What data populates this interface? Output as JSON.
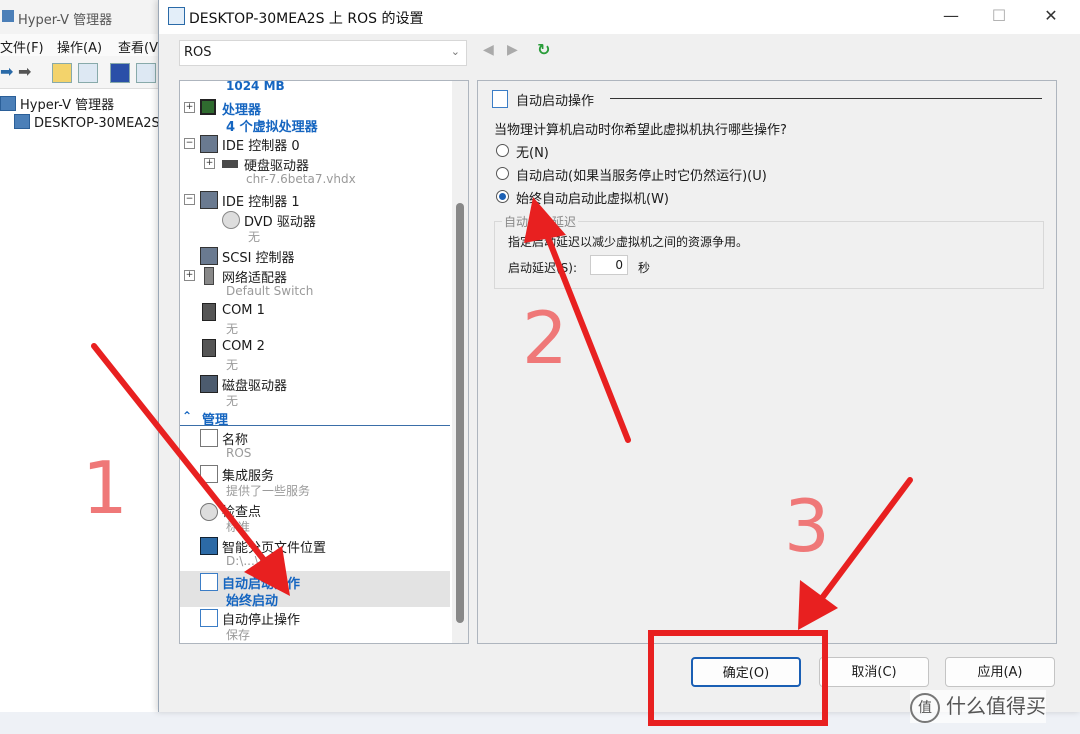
{
  "background_window": {
    "title": "Hyper-V 管理器",
    "menu": [
      "文件(F)",
      "操作(A)",
      "查看(V"
    ],
    "tree": [
      "Hyper-V 管理器",
      "DESKTOP-30MEA2S"
    ]
  },
  "dialog": {
    "title": "DESKTOP-30MEA2S 上 ROS 的设置",
    "minimize": "—",
    "maximize": "☐",
    "close": "✕",
    "vm_select": "ROS",
    "nav_back": "◀",
    "nav_forward": "▶",
    "refresh": "↻"
  },
  "left_panel": {
    "memory_sub": "1024 MB",
    "processor": {
      "label": "处理器",
      "sub": "4 个虚拟处理器"
    },
    "ide0": {
      "label": "IDE 控制器 0"
    },
    "hdd": {
      "label": "硬盘驱动器",
      "sub": "chr-7.6beta7.vhdx"
    },
    "ide1": {
      "label": "IDE 控制器 1"
    },
    "dvd": {
      "label": "DVD 驱动器",
      "sub": "无"
    },
    "scsi": {
      "label": "SCSI 控制器"
    },
    "network": {
      "label": "网络适配器",
      "sub": "Default Switch"
    },
    "com1": {
      "label": "COM 1",
      "sub": "无"
    },
    "com2": {
      "label": "COM 2",
      "sub": "无"
    },
    "floppy": {
      "label": "磁盘驱动器",
      "sub": "无"
    },
    "management": "管理",
    "name": {
      "label": "名称",
      "sub": "ROS"
    },
    "integration": {
      "label": "集成服务",
      "sub": "提供了一些服务"
    },
    "checkpoint": {
      "label": "检查点",
      "sub": "标准"
    },
    "paging": {
      "label": "智能分页文件位置",
      "sub": "D:\\...\\ROS"
    },
    "autostart": {
      "label": "自动启动操作",
      "sub": "始终启动"
    },
    "autostop": {
      "label": "自动停止操作",
      "sub": "保存"
    }
  },
  "right_panel": {
    "header": "自动启动操作",
    "question": "当物理计算机启动时你希望此虚拟机执行哪些操作?",
    "options": [
      {
        "label": "无(N)",
        "selected": false
      },
      {
        "label": "自动启动(如果当服务停止时它仍然运行)(U)",
        "selected": false
      },
      {
        "label": "始终自动启动此虚拟机(W)",
        "selected": true
      }
    ],
    "group_legend": "自动启动延迟",
    "group_desc": "指定启动延迟以减少虚拟机之间的资源争用。",
    "delay_label": "启动延迟(S):",
    "delay_value": "0",
    "delay_unit": "秒"
  },
  "buttons": {
    "ok": "确定(O)",
    "cancel": "取消(C)",
    "apply": "应用(A)"
  },
  "annotations": {
    "n1": "1",
    "n2": "2",
    "n3": "3",
    "color": "#e82020"
  },
  "watermark": {
    "logo": "值",
    "text": "什么值得买"
  }
}
